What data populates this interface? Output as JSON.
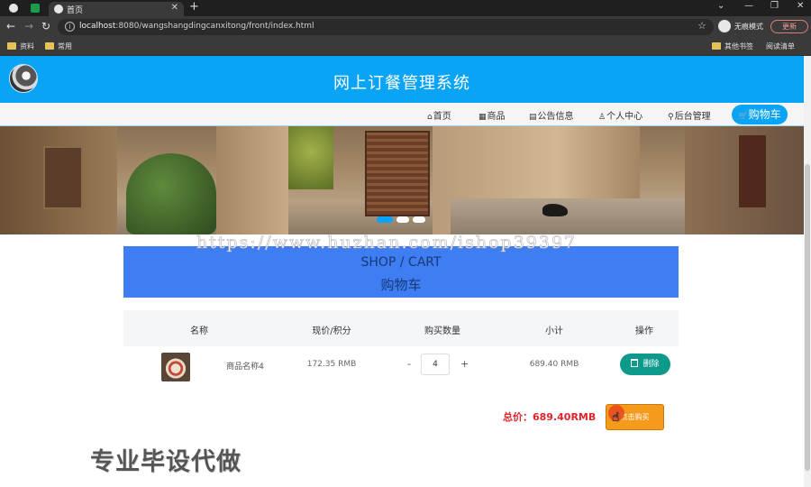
{
  "browser": {
    "tab_title": "首页",
    "tab_close": "✕",
    "new_tab": "+",
    "window_controls": [
      "⌄",
      "—",
      "❐",
      "✕"
    ],
    "nav": {
      "back": "←",
      "forward": "→",
      "reload": "↻"
    },
    "url_host": "localhost",
    "url_rest": ":8080/wangshangdingcanxitong/front/index.html",
    "info_icon": "i",
    "star": "☆",
    "incognito_label": "无痕模式",
    "update_label": "更新",
    "bookmarks": [
      "资料",
      "常用"
    ],
    "bookmarks_right": [
      "其他书签",
      "阅读清单"
    ]
  },
  "site": {
    "title": "网上订餐管理系统",
    "nav": [
      {
        "icon": "⌂",
        "label": "首页"
      },
      {
        "icon": "▦",
        "label": "商品"
      },
      {
        "icon": "▤",
        "label": "公告信息"
      },
      {
        "icon": "♙",
        "label": "个人中心"
      },
      {
        "icon": "⚲",
        "label": "后台管理"
      }
    ],
    "cart_icon": "🛒",
    "cart_label": "购物车"
  },
  "carousel": {
    "dots": 3,
    "active_index": 0
  },
  "watermark": "https://www.huzhan.com/ishop39397",
  "cart": {
    "title_en": "SHOP / CART",
    "title_cn": "购物车",
    "columns": [
      "名称",
      "现价/积分",
      "购买数量",
      "小计",
      "操作"
    ],
    "rows": [
      {
        "name": "商品名称4",
        "price": "172.35 RMB",
        "quantity": "4",
        "subtotal": "689.40 RMB",
        "delete_label": "删除"
      }
    ],
    "qty_minus": "-",
    "qty_plus": "+",
    "total_label": "总价：689.40RMB",
    "buy_label": "点击购买"
  },
  "promo_text": "专业毕设代做",
  "colors": {
    "header_blue": "#0aa4f6",
    "shop_head": "#3f7df2",
    "delete_teal": "#0e9a8a",
    "buy_orange": "#f59a1b",
    "total_red": "#e0242b"
  }
}
